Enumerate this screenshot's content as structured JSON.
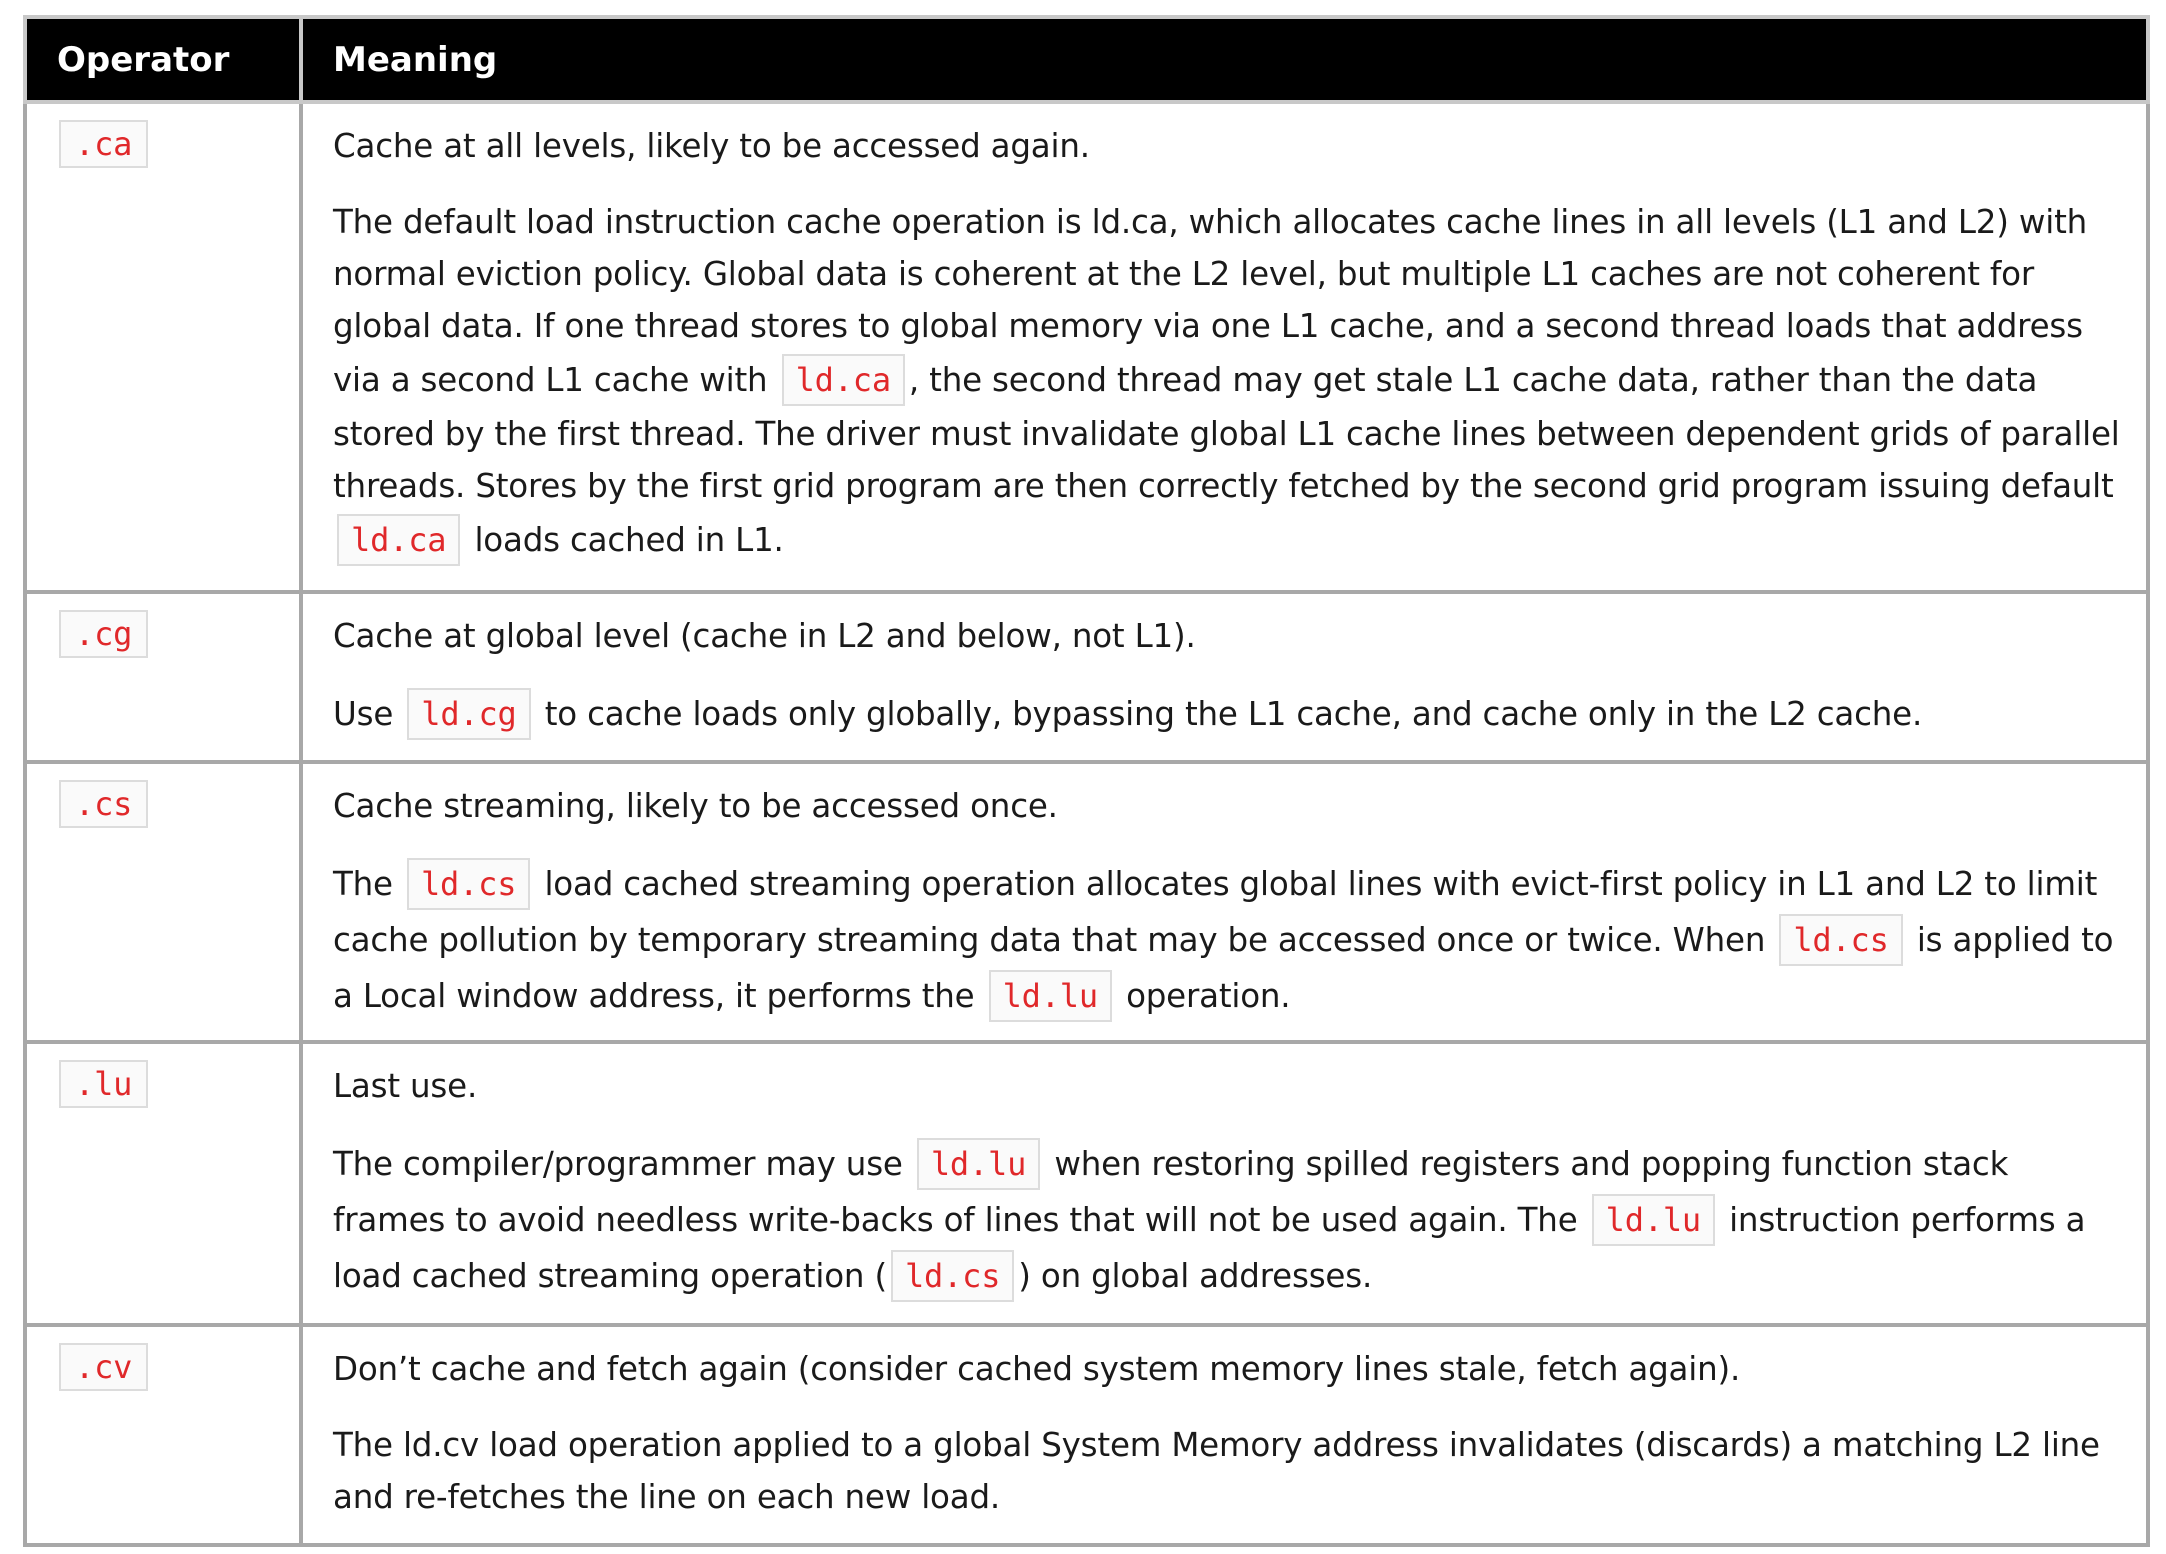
{
  "table": {
    "header": {
      "operator": "Operator",
      "meaning": "Meaning"
    },
    "rows": [
      {
        "operator": ".ca",
        "summary": "Cache at all levels, likely to be accessed again.",
        "details": [
          "The default load instruction cache operation is ld.ca, which allocates cache lines in all levels (L1 and L2) with normal eviction policy. Global data is coherent at the L2 level, but multiple L1 caches are not coherent for global data. If one thread stores to global memory via one L1 cache, and a second thread loads that address via a second L1 cache with ",
          "ld.ca",
          ", the second thread may get stale L1 cache data, rather than the data stored by the first thread. The driver must invalidate global L1 cache lines between dependent grids of parallel threads. Stores by the first grid program are then correctly fetched by the second grid program issuing default ",
          "ld.ca",
          " loads cached in L1."
        ]
      },
      {
        "operator": ".cg",
        "summary": "Cache at global level (cache in L2 and below, not L1).",
        "details": [
          "Use ",
          "ld.cg",
          " to cache loads only globally, bypassing the L1 cache, and cache only in the L2 cache."
        ]
      },
      {
        "operator": ".cs",
        "summary": "Cache streaming, likely to be accessed once.",
        "details": [
          "The ",
          "ld.cs",
          " load cached streaming operation allocates global lines with evict-first policy in L1 and L2 to limit cache pollution by temporary streaming data that may be accessed once or twice. When ",
          "ld.cs",
          " is applied to a Local window address, it performs the ",
          "ld.lu",
          " operation."
        ]
      },
      {
        "operator": ".lu",
        "summary": "Last use.",
        "details": [
          "The compiler/programmer may use ",
          "ld.lu",
          " when restoring spilled registers and popping function stack frames to avoid needless write-backs of lines that will not be used again. The ",
          "ld.lu",
          " instruction performs a load cached streaming operation (",
          "ld.cs",
          ") on global addresses."
        ]
      },
      {
        "operator": ".cv",
        "summary": "Don’t cache and fetch again (consider cached system memory lines stale, fetch again).",
        "details": [
          "The ld.cv load operation applied to a global System Memory address invalidates (discards) a matching L2 line and re-fetches the line on each new load."
        ]
      }
    ]
  }
}
